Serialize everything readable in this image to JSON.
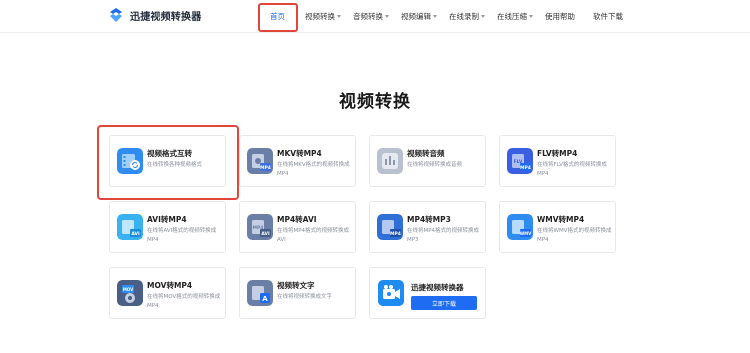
{
  "header": {
    "app_name": "迅捷视频转换器",
    "nav": [
      {
        "label": "首页",
        "dropdown": false,
        "active": true
      },
      {
        "label": "视频转换",
        "dropdown": true
      },
      {
        "label": "音频转换",
        "dropdown": true
      },
      {
        "label": "视频编辑",
        "dropdown": true
      },
      {
        "label": "在线录制",
        "dropdown": true
      },
      {
        "label": "在线压缩",
        "dropdown": true
      },
      {
        "label": "使用帮助",
        "dropdown": false
      },
      {
        "label": "软件下载",
        "dropdown": false
      }
    ]
  },
  "main": {
    "title": "视频转换",
    "cards": [
      {
        "title": "视频格式互转",
        "desc": "在线转换各种视频格式",
        "icon": "video-convert-icon",
        "color": "#2f8cf0"
      },
      {
        "title": "MKV转MP4",
        "desc": "在线将MKV格式的视频转换成MP4",
        "icon": "mkv-to-mp4-icon",
        "badge": "MP4",
        "color": "#6b7fa6"
      },
      {
        "title": "视频转音频",
        "desc": "在线将视频转换成音频",
        "icon": "video-to-audio-icon",
        "color": "#b8c1cf"
      },
      {
        "title": "FLV转MP4",
        "desc": "在线将FLV格式的视频转换成MP4",
        "icon": "flv-to-mp4-icon",
        "badge": "MP4",
        "color": "#3a5fe0"
      },
      {
        "title": "AVI转MP4",
        "desc": "在线将AVI格式的视频转换成MP4",
        "icon": "avi-to-mp4-icon",
        "badge": "AVI",
        "color": "#38b2f0"
      },
      {
        "title": "MP4转AVI",
        "desc": "在线将MP4格式的视频转换成AVI",
        "icon": "mp4-to-avi-icon",
        "badge": "AVI",
        "color": "#6b7fa6"
      },
      {
        "title": "MP4转MP3",
        "desc": "在线将MP4格式的视频转换成MP3",
        "icon": "mp4-to-mp3-icon",
        "badge": "MP4",
        "color": "#2f6fd6"
      },
      {
        "title": "WMV转MP4",
        "desc": "在线将WMV格式的视频转换成MP4",
        "icon": "wmv-to-mp4-icon",
        "badge": "WMV",
        "color": "#2f8cf0"
      },
      {
        "title": "MOV转MP4",
        "desc": "在线将MOV格式的视频转换成MP4",
        "icon": "mov-to-mp4-icon",
        "badge": "MOV",
        "color": "#4a5f86"
      },
      {
        "title": "视频转文字",
        "desc": "在线将视频转换成文字",
        "icon": "video-to-text-icon",
        "color": "#6b7fa6"
      }
    ],
    "promo": {
      "title": "迅捷视频转换器",
      "button": "立即下载",
      "icon": "app-download-icon",
      "color": "#1e8cf2"
    }
  },
  "colors": {
    "accent": "#1e6cf2",
    "highlight": "#e0463a"
  }
}
